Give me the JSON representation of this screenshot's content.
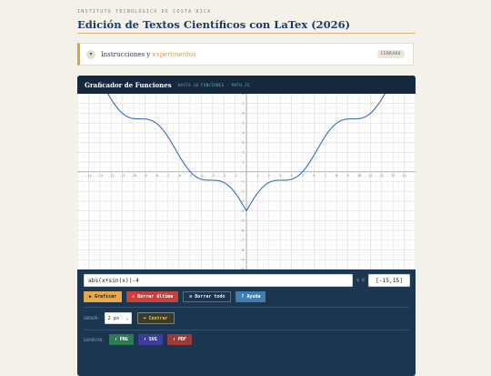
{
  "header": {
    "institute": "INSTITUTO TECNOLÓGICO DE COSTA RICA",
    "title": "Edición de Textos Científicos con LaTex (2026)"
  },
  "instructions": {
    "toggle_icon": "chevron-down-icon",
    "label_main": "Instrucciones y ",
    "label_italic": "experimentos",
    "badge": "CERRADO"
  },
  "panel": {
    "title": "Graficador de Funciones",
    "subtitle": "HASTA 10 FUNCIONES · MATH.JS"
  },
  "controls": {
    "expression": "abs(x+sin(x))-4",
    "x_label": "x ∈",
    "range": "[-15,15]",
    "graficar": "▶ Graficar",
    "borrar_ultima": "✕ Borrar última",
    "borrar_todo": "⊘ Borrar todo",
    "ayuda": "? Ayuda",
    "grosor_label": "GROSOR:",
    "grosor_value": "2 px",
    "centrar": "⌖ Centrar",
    "exportar_label": "EXPORTAR:",
    "png": "⬇ PNG",
    "svg": "⬇ SVG",
    "pdf": "⬇ PDF"
  },
  "colors": {
    "accent": "#d8a444",
    "panel": "#1c3550",
    "curve": "#3a6db3"
  },
  "chart_data": {
    "type": "line",
    "function": "abs(x+sin(x))-4",
    "xlim": [
      -15,
      15
    ],
    "ylim": [
      -10,
      8
    ],
    "x_ticks": [
      -14,
      -13,
      -12,
      -11,
      -10,
      -9,
      -8,
      -7,
      -6,
      -5,
      -4,
      -3,
      -2,
      -1,
      1,
      2,
      3,
      4,
      5,
      6,
      7,
      8,
      9,
      10,
      11,
      12,
      13,
      14
    ],
    "y_ticks": [
      -10,
      -9,
      -8,
      -7,
      -6,
      -5,
      -4,
      -3,
      -2,
      -1,
      1,
      2,
      3,
      4,
      5,
      6,
      7,
      8
    ],
    "grid": true
  }
}
